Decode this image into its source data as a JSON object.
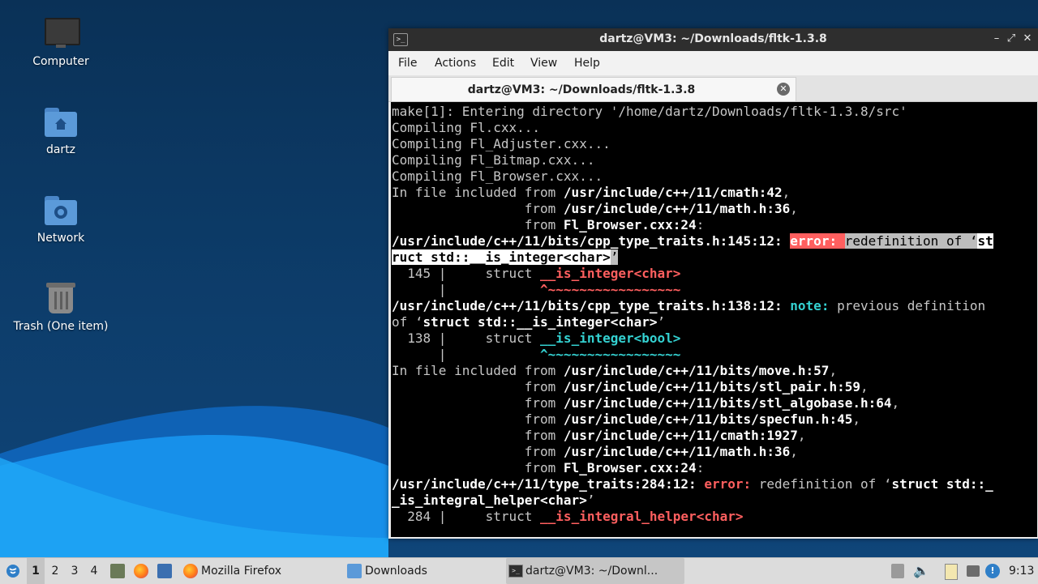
{
  "desktop": {
    "icons": [
      {
        "label": "Computer",
        "icon": "computer-icon"
      },
      {
        "label": "dartz",
        "icon": "home-folder-icon"
      },
      {
        "label": "Network",
        "icon": "network-folder-icon"
      },
      {
        "label": "Trash (One item)",
        "icon": "trash-icon"
      }
    ]
  },
  "window": {
    "title": "dartz@VM3: ~/Downloads/fltk-1.3.8",
    "controls": {
      "minimize": "–",
      "maximize": "⤢",
      "close": "✕"
    },
    "menu": [
      "File",
      "Actions",
      "Edit",
      "View",
      "Help"
    ],
    "tab_title": "dartz@VM3: ~/Downloads/fltk-1.3.8"
  },
  "terminal": {
    "lines": [
      "make[1]: Entering directory '/home/dartz/Downloads/fltk-1.3.8/src'",
      "Compiling Fl.cxx...",
      "Compiling Fl_Adjuster.cxx...",
      "Compiling Fl_Bitmap.cxx...",
      "Compiling Fl_Browser.cxx...",
      {
        "p1": "In file included from ",
        "b": "/usr/include/c++/11/cmath:42",
        "p2": ","
      },
      {
        "p1": "                 from ",
        "b": "/usr/include/c++/11/math.h:36",
        "p2": ","
      },
      {
        "p1": "                 from ",
        "b": "Fl_Browser.cxx:24",
        "p2": ":"
      },
      {
        "loc": "/usr/include/c++/11/bits/cpp_type_traits.h:145:12: ",
        "kind": "error:",
        "sp": " ",
        "msg": "redefinition of ‘",
        "tail": "st"
      },
      {
        "cont": "ruct std::__is_integer<char>",
        "q": "’"
      },
      {
        "num": "  145 |     struct ",
        "sym": "__is_integer<char>"
      },
      {
        "pad": "      |            ",
        "caret": "^~~~~~~~~~~~~~~~~~"
      },
      {
        "loc": "/usr/include/c++/11/bits/cpp_type_traits.h:138:12: ",
        "kind": "note:",
        "msg": " previous definition"
      },
      {
        "pre": "of ‘",
        "b": "struct std::__is_integer<char>",
        "post": "’"
      },
      {
        "num": "  138 |     struct ",
        "sym": "__is_integer<bool>"
      },
      {
        "pad": "      |            ",
        "caret": "^~~~~~~~~~~~~~~~~~"
      },
      {
        "p1": "In file included from ",
        "b": "/usr/include/c++/11/bits/move.h:57",
        "p2": ","
      },
      {
        "p1": "                 from ",
        "b": "/usr/include/c++/11/bits/stl_pair.h:59",
        "p2": ","
      },
      {
        "p1": "                 from ",
        "b": "/usr/include/c++/11/bits/stl_algobase.h:64",
        "p2": ","
      },
      {
        "p1": "                 from ",
        "b": "/usr/include/c++/11/bits/specfun.h:45",
        "p2": ","
      },
      {
        "p1": "                 from ",
        "b": "/usr/include/c++/11/cmath:1927",
        "p2": ","
      },
      {
        "p1": "                 from ",
        "b": "/usr/include/c++/11/math.h:36",
        "p2": ","
      },
      {
        "p1": "                 from ",
        "b": "Fl_Browser.cxx:24",
        "p2": ":"
      },
      {
        "loc": "/usr/include/c++/11/type_traits:284:12: ",
        "kind": "error:",
        "msg": " redefinition of ‘",
        "b2": "struct std::_"
      },
      {
        "b": "_is_integral_helper<char>",
        "post": "’"
      },
      {
        "num": "  284 |     struct ",
        "sym": "__is_integral_helper<char>"
      }
    ]
  },
  "taskbar": {
    "workspaces": [
      "1",
      "2",
      "3",
      "4"
    ],
    "tasks": [
      "Mozilla Firefox",
      "Downloads",
      "dartz@VM3: ~/Downl..."
    ],
    "clock": "9:13"
  },
  "colors": {
    "error": "#ff5f5f",
    "note": "#34d1d1",
    "terminal_bg": "#000000"
  }
}
